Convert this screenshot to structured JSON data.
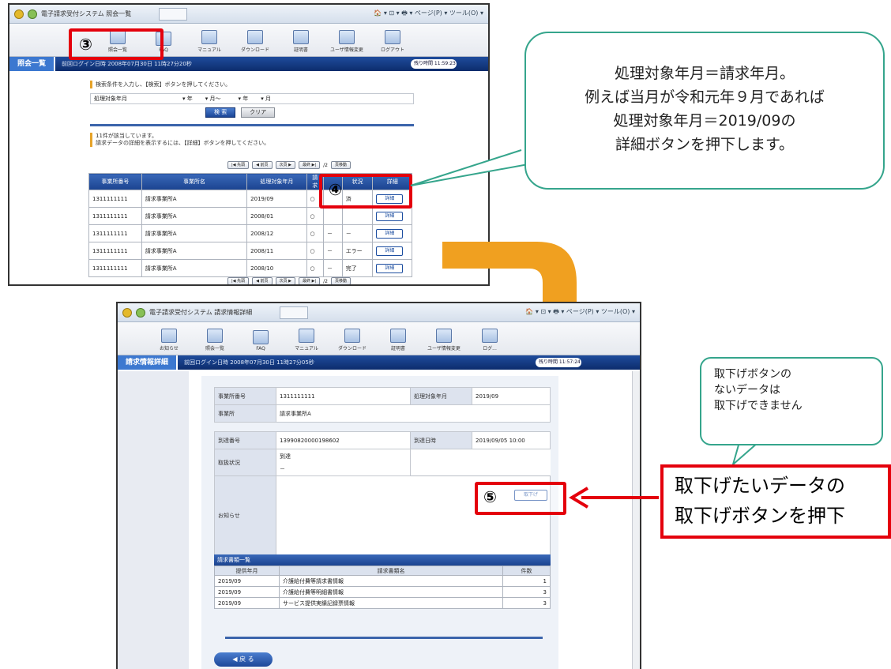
{
  "top_window": {
    "tab_title": "電子請求受付システム 照会一覧",
    "browser_tools": "🏠 ▾ ⊡ ▾ 🖶 ▾ ページ(P) ▾ ツール(O) ▾",
    "toolbar": [
      {
        "label": "照会一覧"
      },
      {
        "label": "FAQ"
      },
      {
        "label": "マニュアル"
      },
      {
        "label": "ダウンロード"
      },
      {
        "label": "証明書"
      },
      {
        "label": "ユーザ情報変更"
      },
      {
        "label": "ログアウト"
      }
    ],
    "bar_title": "照会一覧",
    "bar_info": "前回ログイン日時 2008年07月30日 11時27分20秒",
    "time_label": "残り時間 11:59:23",
    "instruction": "検索条件を入力し、【検索】ボタンを押してください。",
    "search_label": "処理対象年月",
    "search_fields": {
      "y1": "年",
      "m1": "月～",
      "y2": "年",
      "m2": "月"
    },
    "search_button": "検 索",
    "clear_button": "クリア",
    "result_msg_1": "11件が該当しています。",
    "result_msg_2": "請求データの詳細を表示するには、【詳細】ボタンを押してください。",
    "pager_top": [
      "|◀ 先頭",
      "◀ 前頁",
      "次頁 ▶",
      "最終 ▶|",
      "/2",
      "頁移動"
    ],
    "table_headers": [
      "事業所番号",
      "事業所名",
      "処理対象年月",
      "請求",
      "",
      "状況",
      "詳細"
    ],
    "rows": [
      {
        "no": "1311111111",
        "name": "請求事業所A",
        "ym": "2019/09",
        "c1": "○",
        "c2": "",
        "status": "済",
        "btn": "詳細"
      },
      {
        "no": "1311111111",
        "name": "請求事業所A",
        "ym": "2008/01",
        "c1": "○",
        "c2": "",
        "status": "",
        "btn": "詳細"
      },
      {
        "no": "1311111111",
        "name": "請求事業所A",
        "ym": "2008/12",
        "c1": "○",
        "c2": "－",
        "status": "－",
        "btn": "詳細"
      },
      {
        "no": "1311111111",
        "name": "請求事業所A",
        "ym": "2008/11",
        "c1": "○",
        "c2": "－",
        "status": "エラー",
        "btn": "詳細"
      },
      {
        "no": "1311111111",
        "name": "請求事業所A",
        "ym": "2008/10",
        "c1": "○",
        "c2": "－",
        "status": "完了",
        "btn": "詳細"
      }
    ],
    "pager_bottom": [
      "|◀ 先頭",
      "◀ 前頁",
      "次頁 ▶",
      "最終 ▶|",
      "/2",
      "頁移動"
    ]
  },
  "bottom_window": {
    "tab_title": "電子請求受付システム 請求情報詳細",
    "browser_tools": "🏠 ▾ ⊡ ▾ 🖶 ▾ ページ(P) ▾ ツール(O) ▾",
    "toolbar": [
      {
        "label": "お知らせ"
      },
      {
        "label": "照会一覧"
      },
      {
        "label": "FAQ"
      },
      {
        "label": "マニュアル"
      },
      {
        "label": "ダウンロード"
      },
      {
        "label": "証明書"
      },
      {
        "label": "ユーザ情報変更"
      },
      {
        "label": "ログ..."
      }
    ],
    "bar_title": "請求情報詳細",
    "bar_info": "前回ログイン日時 2008年07月30日 11時27分05秒",
    "time_label": "残り時間 11:57:24",
    "fields": {
      "office_no_label": "事業所番号",
      "office_no": "1311111111",
      "target_label": "処理対象年月",
      "target": "2019/09",
      "office_label": "事業所",
      "office": "請求事業所A",
      "arrival_no_label": "到達番号",
      "arrival_no": "13990820000198602",
      "arrival_dt_label": "到達日時",
      "arrival_dt": "2019/09/05 10:00",
      "status_label": "取扱状況",
      "status": "到達",
      "status2": "－",
      "notice_label": "お知らせ"
    },
    "withdraw_button": "取下げ",
    "list_title": "請求書類一覧",
    "list_headers": [
      "提供年月",
      "請求書類名",
      "件数"
    ],
    "list_rows": [
      {
        "ym": "2019/09",
        "name": "介護給付費等請求書情報",
        "count": "1"
      },
      {
        "ym": "2019/09",
        "name": "介護給付費等明細書情報",
        "count": "3"
      },
      {
        "ym": "2019/09",
        "name": "サービス提供実績記録票情報",
        "count": "3"
      }
    ],
    "back_button": "戻 る"
  },
  "annotations": {
    "step3": "③",
    "step4": "④",
    "step5": "⑤",
    "callout1": [
      "処理対象年月＝請求年月。",
      "例えば当月が令和元年９月であれば",
      "処理対象年月＝2019/09の",
      "詳細ボタンを押下します。"
    ],
    "callout2": [
      "取下げボタンの",
      "ないデータは",
      "取下げできません"
    ],
    "red_panel": [
      "取下げたいデータの",
      "取下げボタンを押下"
    ]
  },
  "colors": {
    "accent_red": "#e4000c",
    "callout_green": "#35a58c",
    "arrow_orange": "#f0a020",
    "header_blue": "#0c2c6c"
  }
}
